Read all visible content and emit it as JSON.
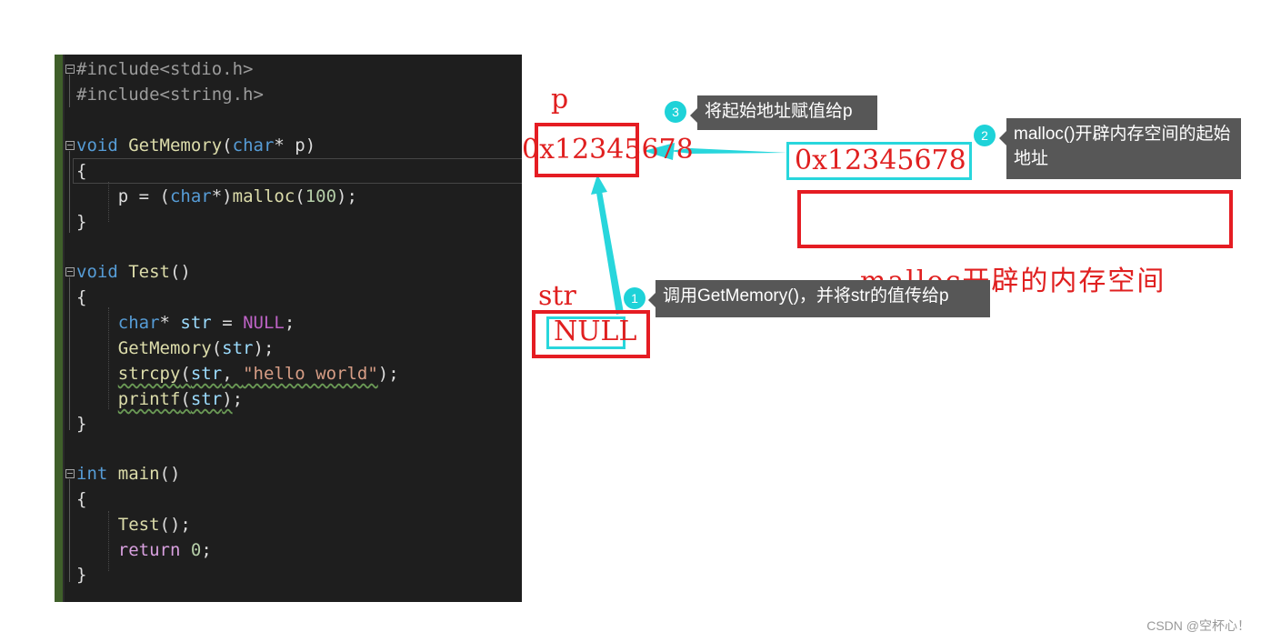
{
  "code": {
    "l1": "#include<stdio.h>",
    "l2": "#include<string.h>",
    "l4_kw": "void",
    "l4_fn": "GetMemory",
    "l4_type": "char",
    "l4_rest": "* p)",
    "l5": "{",
    "l6_a": "p = (",
    "l6_type": "char",
    "l6_b": "*)",
    "l6_fn": "malloc",
    "l6_num": "100",
    "l6_c": ");",
    "l7": "}",
    "l9_kw": "void",
    "l9_fn": "Test",
    "l9_rest": "()",
    "l10": "{",
    "l11_type": "char",
    "l11_a": "* ",
    "l11_var": "str",
    "l11_b": " = ",
    "l11_null": "NULL",
    "l11_c": ";",
    "l12_fn": "GetMemory",
    "l12_var": "str",
    "l13_fn": "strcpy",
    "l13_var": "str",
    "l13_str": "\"hello world\"",
    "l14_fn": "printf",
    "l14_var": "str",
    "l15": "}",
    "l17_kw": "int",
    "l17_fn": "main",
    "l17_rest": "()",
    "l18": "{",
    "l19_fn": "Test",
    "l19_rest": "();",
    "l20_kw": "return",
    "l20_num": "0",
    "l20_rest": ";",
    "l21": "}"
  },
  "diagram": {
    "p_label": "p",
    "p_value": "0x12345678",
    "address_value": "0x12345678",
    "str_label": "str",
    "str_value": "NULL",
    "malloc_caption": "malloc开辟的内存空间",
    "steps": [
      {
        "number": "1",
        "text": "调用GetMemory()，并将str的值传给p"
      },
      {
        "number": "2",
        "text": "malloc()开辟内存空间的起始地址"
      },
      {
        "number": "3",
        "text": "将起始地址赋值给p"
      }
    ]
  },
  "watermark": "CSDN @空杯心！",
  "colors": {
    "red": "#e51c23",
    "cyan": "#28d6dc",
    "tooltip": "#575757",
    "editor_bg": "#1e1e1e"
  }
}
